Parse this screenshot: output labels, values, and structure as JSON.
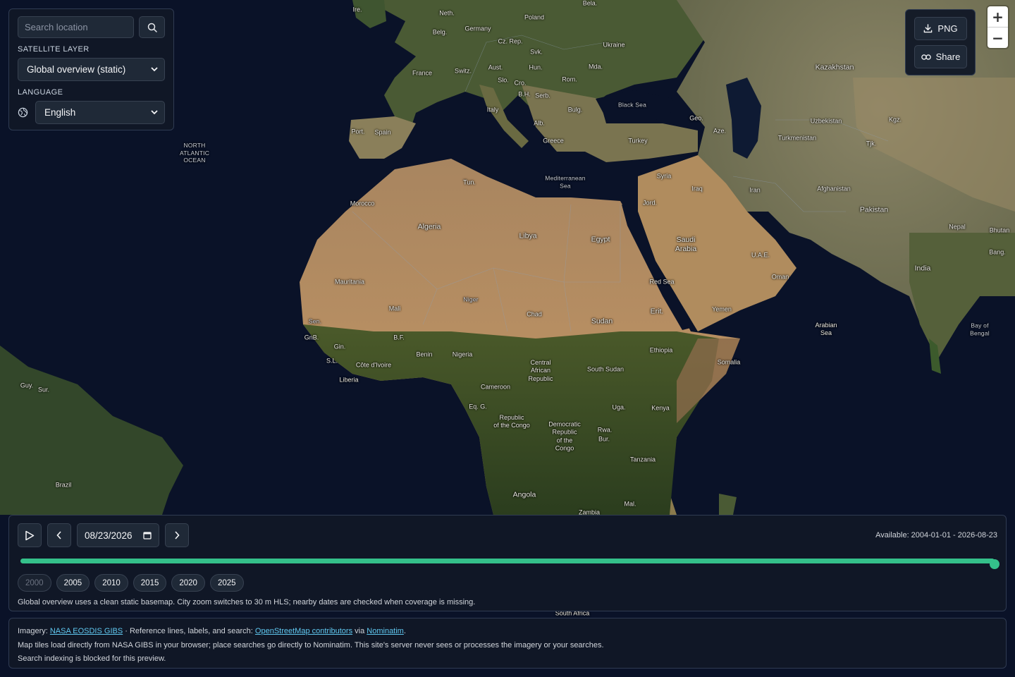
{
  "search": {
    "placeholder": "Search location",
    "icon": "search-icon"
  },
  "satellite": {
    "label": "SATELLITE LAYER",
    "selected": "Global overview (static)"
  },
  "language": {
    "label": "LANGUAGE",
    "selected": "English",
    "icon": "globe-icon"
  },
  "export": {
    "png_label": "PNG",
    "share_label": "Share"
  },
  "zoom": {
    "in_label": "+",
    "out_label": "−"
  },
  "timeline": {
    "date_value": "08/23/2026",
    "available": "Available: 2004-01-01 - 2026-08-23",
    "progress_fraction": 1.0,
    "years": [
      {
        "label": "2000",
        "disabled": true
      },
      {
        "label": "2005",
        "disabled": false
      },
      {
        "label": "2010",
        "disabled": false
      },
      {
        "label": "2015",
        "disabled": false
      },
      {
        "label": "2020",
        "disabled": false
      },
      {
        "label": "2025",
        "disabled": false
      }
    ],
    "note": "Global overview uses a clean static basemap. City zoom switches to 30 m HLS; nearby dates are checked when coverage is missing."
  },
  "attribution": {
    "imagery_prefix": "Imagery: ",
    "imagery_link": "NASA EOSDIS GIBS",
    "ref_text": " · Reference lines, labels, and search: ",
    "osm_link": "OpenStreetMap contributors",
    "via_text": " via ",
    "nominatim_link": "Nominatim",
    "end_text": ".",
    "line2": "Map tiles load directly from NASA GIBS in your browser; place searches go directly to Nominatim. This site's server never sees or processes the imagery or your searches.",
    "line3": "Search indexing is blocked for this preview."
  },
  "map_labels": [
    "Ire.",
    "Neth.",
    "Bela.",
    "Poland",
    "Belg.",
    "Germany",
    "Cz. Rep.",
    "Ukraine",
    "Svk.",
    "Aust.",
    "Hun.",
    "Mda.",
    "France",
    "Switz.",
    "Slo.",
    "Cro.",
    "Rom.",
    "B.H.",
    "Serb.",
    "Kazakhstan",
    "Italy",
    "Bulg.",
    "Black Sea",
    "Alb.",
    "Geo.",
    "Uzbekistan",
    "Port.",
    "Spain",
    "Aze.",
    "Kgz.",
    "Greece",
    "Turkey",
    "Turkmenistan",
    "Tjk.",
    "NORTH\nATLANTIC\nOCEAN",
    "Syria",
    "Mediterranean\nSea",
    "Tun.",
    "Iraq",
    "Iran",
    "Afghanistan",
    "Morocco",
    "Jord.",
    "Pakistan",
    "Algeria",
    "Libya",
    "Egypt",
    "Saudi\nArabia",
    "Nepal",
    "Bhutan",
    "Bang.",
    "U.A.E.",
    "India",
    "Oman",
    "Mauritania",
    "Red Sea",
    "Niger",
    "Mali",
    "Chad",
    "Erit.",
    "Sudan",
    "Yemen",
    "Arabian\nSea",
    "Bay of\nBengal",
    "Sen.",
    "GnB.",
    "B.F.",
    "Gin.",
    "Benin",
    "Nigeria",
    "Ethiopia",
    "S.L.",
    "Côte d'Ivoire",
    "Central\nAfrican\nRepublic",
    "Somalia",
    "Liberia",
    "South Sudan",
    "Guy.",
    "Sur.",
    "Cameroon",
    "Eq. G.",
    "Uga.",
    "Kenya",
    "Republic\nof the Congo",
    "Democratic\nRepublic\nof the\nCongo",
    "Rwa.",
    "Bur.",
    "Tanzania",
    "Brazil",
    "Angola",
    "Mal.",
    "Zambia",
    "South Africa"
  ],
  "colors": {
    "accent": "#34c08a",
    "link": "#60c8f0",
    "panel": "#111827",
    "ocean": "#0a1228"
  }
}
